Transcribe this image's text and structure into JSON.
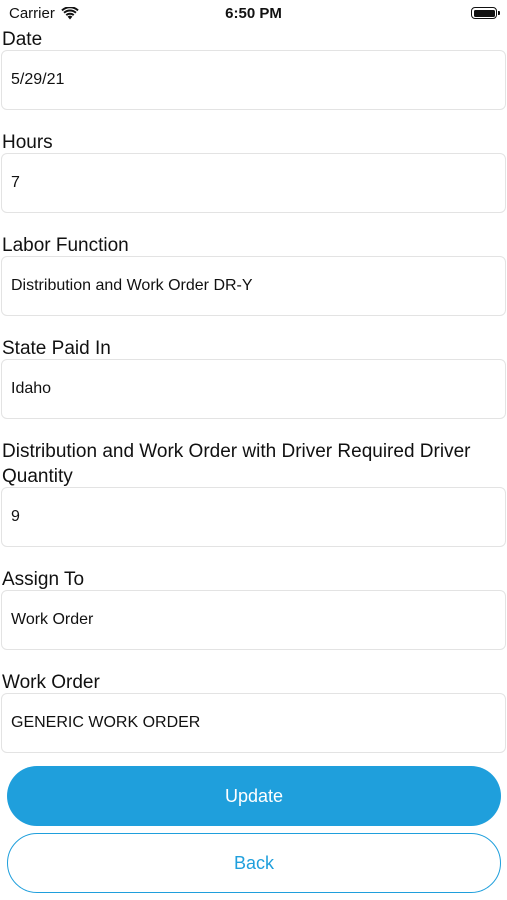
{
  "status_bar": {
    "carrier": "Carrier",
    "time": "6:50 PM"
  },
  "fields": [
    {
      "label": "Date",
      "value": "5/29/21"
    },
    {
      "label": "Hours",
      "value": "7"
    },
    {
      "label": "Labor Function",
      "value": "Distribution and Work Order DR-Y"
    },
    {
      "label": "State Paid In",
      "value": "Idaho"
    },
    {
      "label": "Distribution and Work Order with Driver Required Driver Quantity",
      "value": "9"
    },
    {
      "label": "Assign To",
      "value": "Work Order"
    },
    {
      "label": "Work Order",
      "value": "GENERIC WORK ORDER"
    }
  ],
  "buttons": {
    "update_label": "Update",
    "back_label": "Back"
  },
  "colors": {
    "accent": "#1f9fdc",
    "field_border": "#e3e3e3"
  }
}
